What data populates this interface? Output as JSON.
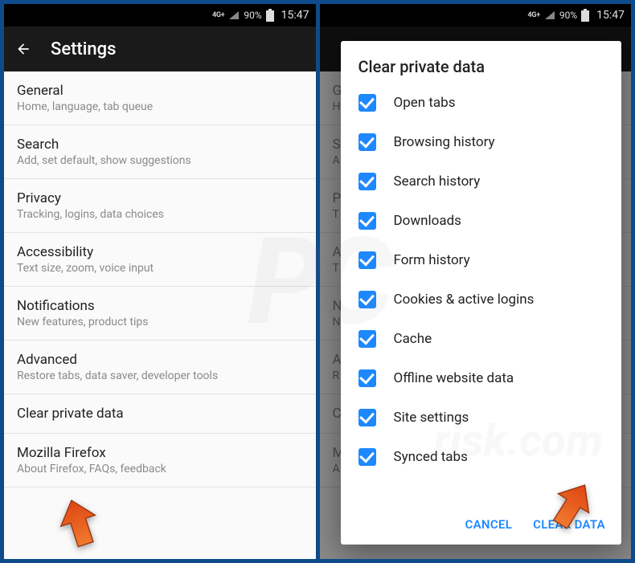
{
  "statusbar": {
    "network": "4G+",
    "battery": "90%",
    "time": "15:47"
  },
  "settings": {
    "title": "Settings",
    "items": [
      {
        "label": "General",
        "sub": "Home, language, tab queue"
      },
      {
        "label": "Search",
        "sub": "Add, set default, show suggestions"
      },
      {
        "label": "Privacy",
        "sub": "Tracking, logins, data choices"
      },
      {
        "label": "Accessibility",
        "sub": "Text size, zoom, voice input"
      },
      {
        "label": "Notifications",
        "sub": "New features, product tips"
      },
      {
        "label": "Advanced",
        "sub": "Restore tabs, data saver, developer tools"
      },
      {
        "label": "Clear private data",
        "sub": ""
      },
      {
        "label": "Mozilla Firefox",
        "sub": "About Firefox, FAQs, feedback"
      }
    ]
  },
  "dim_items": [
    {
      "label": "G",
      "sub": "H"
    },
    {
      "label": "S",
      "sub": "A"
    },
    {
      "label": "P",
      "sub": "T"
    },
    {
      "label": "A",
      "sub": "T"
    },
    {
      "label": "N",
      "sub": "N"
    },
    {
      "label": "A",
      "sub": "R"
    },
    {
      "label": "C",
      "sub": ""
    },
    {
      "label": "M",
      "sub": "A"
    }
  ],
  "dialog": {
    "title": "Clear private data",
    "options": [
      "Open tabs",
      "Browsing history",
      "Search history",
      "Downloads",
      "Form history",
      "Cookies & active logins",
      "Cache",
      "Offline website data",
      "Site settings",
      "Synced tabs"
    ],
    "cancel": "CANCEL",
    "confirm": "CLEAR DATA"
  },
  "colors": {
    "accent": "#1e88ff",
    "arrow": "#e8581f"
  }
}
